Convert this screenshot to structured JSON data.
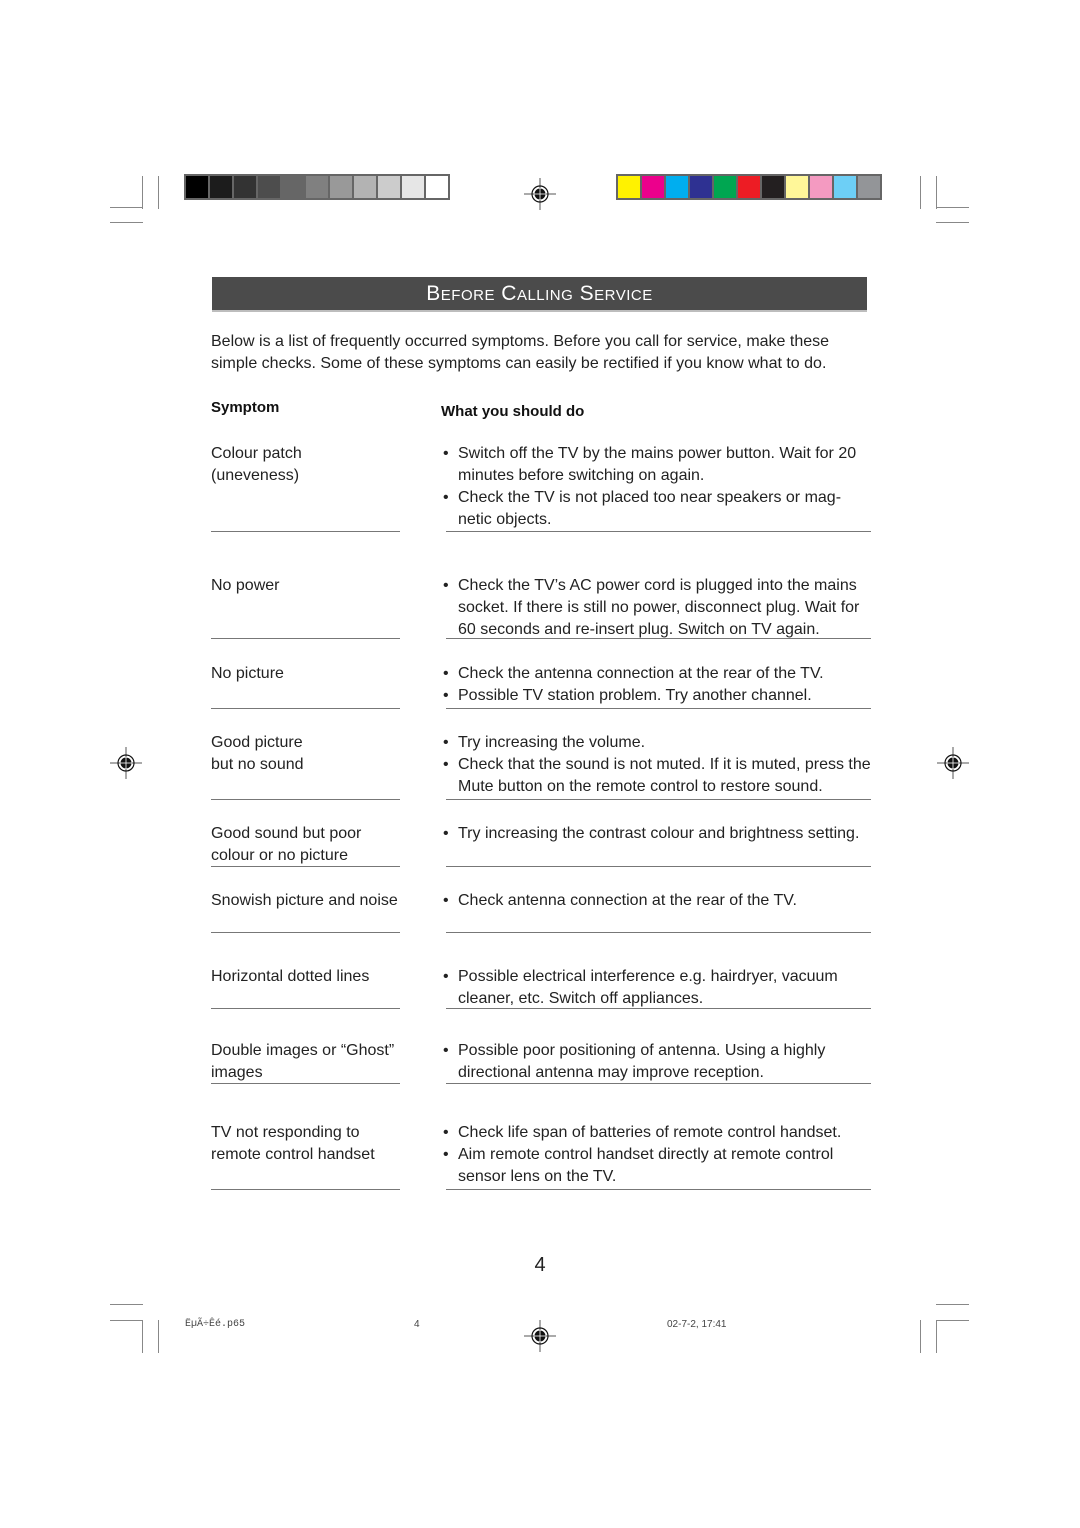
{
  "print_marks": {
    "grayscale_swatches": [
      "#000000",
      "#1c1c1c",
      "#333333",
      "#4d4d4d",
      "#666666",
      "#808080",
      "#999999",
      "#b3b3b3",
      "#cccccc",
      "#e6e6e6",
      "#ffffff"
    ],
    "color_swatches": [
      "#fff200",
      "#ec008c",
      "#00aeef",
      "#2e3192",
      "#00a651",
      "#ed1c24",
      "#231f20",
      "#fff799",
      "#f49ac1",
      "#6dcff6",
      "#939598"
    ]
  },
  "header": {
    "title": "Before Calling Service"
  },
  "intro": "Below is a list of frequently occurred symptoms. Before you call for service, make these simple checks. Some of these symptoms can easily be rectified if you know what to do.",
  "columns": {
    "symptom": "Symptom",
    "action": "What you should do"
  },
  "rows": [
    {
      "symptom": "Colour patch\n(uneveness)",
      "actions": [
        "Switch off the TV by the mains power button. Wait for 20 minutes before switching on again.",
        "Check the TV is not placed too near speakers or mag- netic objects."
      ]
    },
    {
      "symptom": "No power",
      "actions": [
        "Check the TV’s AC power cord is plugged into the mains socket. If there is still no power, disconnect plug. Wait for 60 seconds and re-insert plug. Switch on TV again."
      ]
    },
    {
      "symptom": "No picture",
      "actions": [
        "Check the antenna connection at the rear of the TV.",
        "Possible TV station problem. Try another channel."
      ]
    },
    {
      "symptom": "Good picture\nbut no sound",
      "actions": [
        "Try increasing the volume.",
        "Check that the sound is not muted. If it is muted, press the Mute button on the remote control to restore sound."
      ]
    },
    {
      "symptom": "Good sound but poor colour or no picture",
      "actions": [
        "Try increasing the contrast colour and brightness setting."
      ]
    },
    {
      "symptom": "Snowish picture and noise",
      "actions": [
        "Check antenna connection at the rear of the TV."
      ]
    },
    {
      "symptom": "Horizontal dotted lines",
      "actions": [
        "Possible electrical interference e.g. hairdryer, vacuum cleaner, etc. Switch off appliances."
      ]
    },
    {
      "symptom": "Double images or “Ghost” images",
      "actions": [
        "Possible poor positioning of antenna. Using a highly directional antenna may improve reception."
      ]
    },
    {
      "symptom": "TV not responding to remote control handset",
      "actions": [
        "Check life span of batteries of remote control handset.",
        "Aim remote control handset directly at remote control sensor lens on the TV."
      ]
    }
  ],
  "bullet": "•",
  "page_number": "4",
  "footer": {
    "filename": "ËµÃ÷Êé.p65",
    "page": "4",
    "timestamp": "02-7-2, 17:41"
  }
}
